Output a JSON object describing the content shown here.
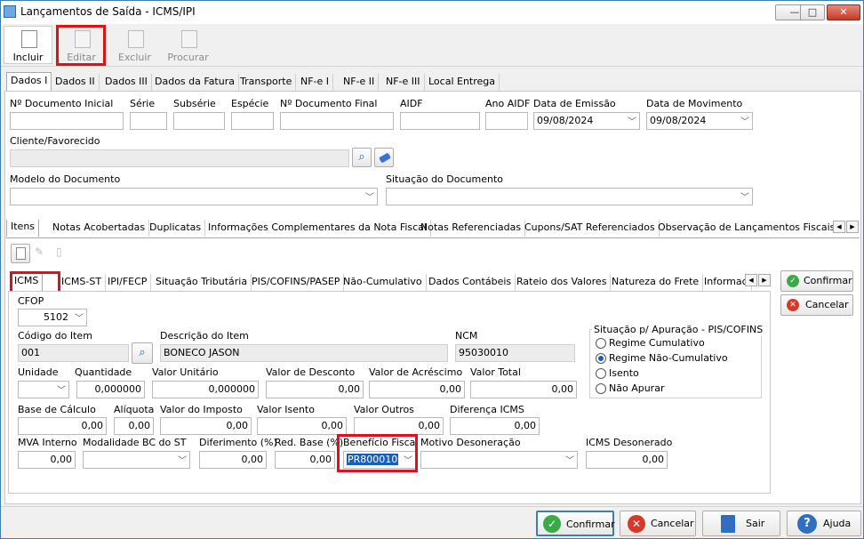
{
  "window": {
    "title": "Lançamentos de Saída - ICMS/IPI",
    "minimize": "—",
    "maximize": "□",
    "close": "✕"
  },
  "toolbar": {
    "incluir": "Incluir",
    "editar": "Editar",
    "excluir": "Excluir",
    "procurar": "Procurar"
  },
  "main_tabs": [
    "Dados I",
    "Dados II",
    "Dados III",
    "Dados da Fatura",
    "Transporte",
    "NF-e I",
    "NF-e II",
    "NF-e III",
    "Local Entrega"
  ],
  "header": {
    "doc_inicial_label": "Nº Documento Inicial",
    "serie_label": "Série",
    "subserie_label": "Subsérie",
    "especie_label": "Espécie",
    "doc_final_label": "Nº Documento Final",
    "aidf_label": "AIDF",
    "ano_aidf_label": "Ano AIDF",
    "data_emissao_label": "Data de Emissão",
    "data_emissao": "09/08/2024",
    "data_movimento_label": "Data de Movimento",
    "data_movimento": "09/08/2024",
    "cliente_label": "Cliente/Favorecido",
    "modelo_label": "Modelo do Documento",
    "situacao_label": "Situação do Documento"
  },
  "item_tabs": [
    "Itens",
    "Notas Acobertadas",
    "Duplicatas",
    "Informações Complementares da Nota Fiscal",
    "Notas Referenciadas",
    "Cupons/SAT Referenciados",
    "Observação de Lançamentos Fiscais (C"
  ],
  "tax_tabs": [
    "ICMS",
    "ICMS-ST",
    "IPI/FECP",
    "Situação Tributária",
    "PIS/COFINS/PASEP",
    "Não-Cumulativo",
    "Dados Contábeis",
    "Rateio dos Valores",
    "Natureza do Frete",
    "Informac"
  ],
  "icms": {
    "cfop_label": "CFOP",
    "cfop": "5102",
    "codigo_label": "Código do Item",
    "codigo": "001",
    "descricao_label": "Descrição do Item",
    "descricao": "BONECO JASON",
    "ncm_label": "NCM",
    "ncm": "95030010",
    "unidade_label": "Unidade",
    "quantidade_label": "Quantidade",
    "quantidade": "0,000000",
    "valor_unitario_label": "Valor Unitário",
    "valor_unitario": "0,000000",
    "valor_desconto_label": "Valor de Desconto",
    "valor_desconto": "0,00",
    "valor_acrescimo_label": "Valor de Acréscimo",
    "valor_acrescimo": "0,00",
    "valor_total_label": "Valor Total",
    "valor_total": "0,00",
    "base_calculo_label": "Base de Cálculo",
    "base_calculo": "0,00",
    "aliquota_label": "Alíquota",
    "aliquota": "0,00",
    "valor_imposto_label": "Valor do Imposto",
    "valor_imposto": "0,00",
    "valor_isento_label": "Valor Isento",
    "valor_isento": "0,00",
    "valor_outros_label": "Valor Outros",
    "valor_outros": "0,00",
    "diferenca_label": "Diferença ICMS",
    "diferenca": "0,00",
    "mva_label": "MVA Interno",
    "mva": "0,00",
    "modalidade_label": "Modalidade BC do ST",
    "diferimento_label": "Diferimento (%)",
    "diferimento": "0,00",
    "red_base_label": "Red. Base (%)",
    "red_base": "0,00",
    "beneficio_label": "Benefício Fiscal",
    "beneficio": "PR800010",
    "motivo_label": "Motivo Desoneração",
    "icms_desonerado_label": "ICMS Desonerado",
    "icms_desonerado": "0,00"
  },
  "pis_cofins": {
    "title": "Situação p/ Apuração - PIS/COFINS",
    "options": [
      "Regime Cumulativo",
      "Regime Não-Cumulativo",
      "Isento",
      "Não Apurar"
    ],
    "selected": 1
  },
  "side_buttons": {
    "confirmar": "Confirmar",
    "cancelar": "Cancelar"
  },
  "footer": {
    "confirmar": "Confirmar",
    "cancelar": "Cancelar",
    "sair": "Sair",
    "ajuda": "Ajuda"
  }
}
